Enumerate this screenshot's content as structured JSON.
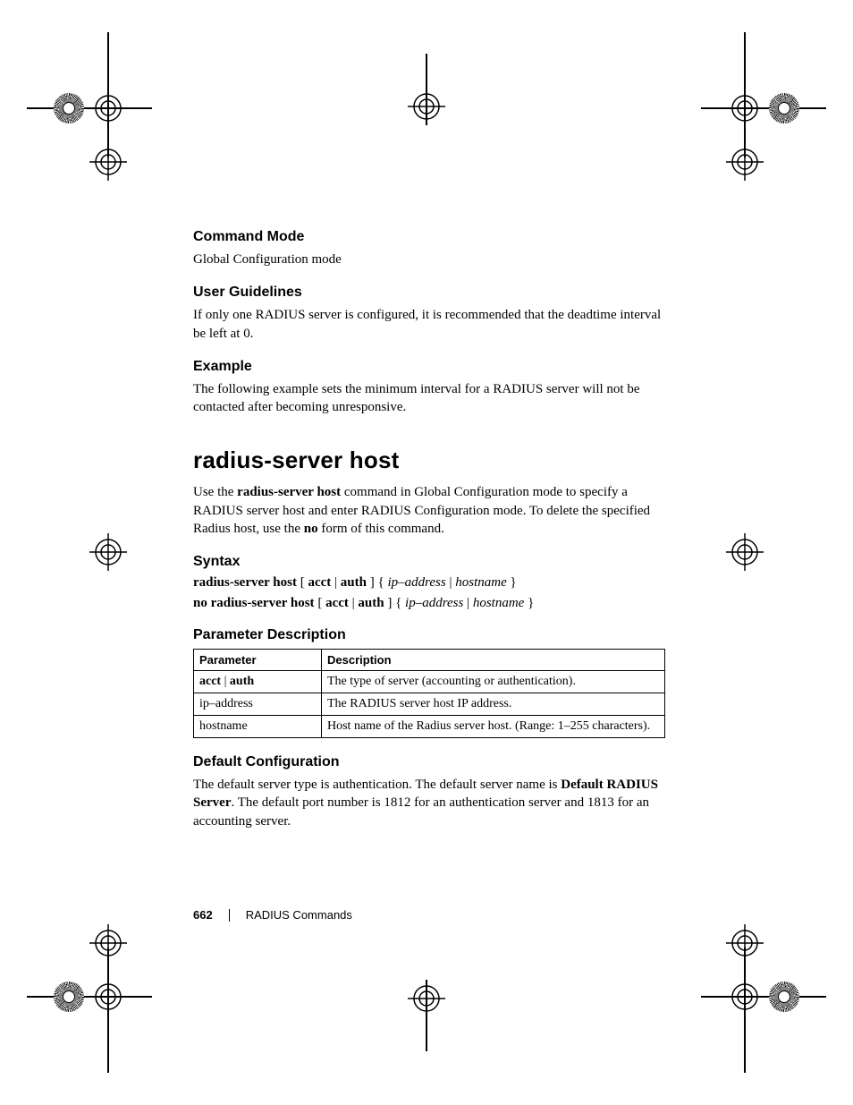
{
  "sections": {
    "command_mode": {
      "heading": "Command Mode",
      "body": "Global Configuration mode"
    },
    "user_guidelines": {
      "heading": "User Guidelines",
      "body": "If only one RADIUS server is configured, it is recommended that the deadtime interval be left at 0."
    },
    "example": {
      "heading": "Example",
      "body": "The following example sets the minimum interval for a RADIUS server will not be contacted after becoming unresponsive."
    },
    "main_heading": "radius-server host",
    "intro": {
      "pre": "Use the ",
      "bold1": "radius-server host",
      "mid": " command in Global Configuration mode to specify a RADIUS server host and enter RADIUS Configuration mode. To delete the specified Radius host, use the ",
      "bold2": "no",
      "post": " form of this command."
    },
    "syntax": {
      "heading": "Syntax",
      "line1": {
        "b1": "radius-server host",
        "t1": " [ ",
        "b2": "acct",
        "t2": " | ",
        "b3": "auth",
        "t3": " ] { ",
        "i1": "ip–address",
        "t4": " | ",
        "i2": "hostname",
        "t5": " }"
      },
      "line2": {
        "b1": "no radius-server host",
        "t1": " [ ",
        "b2": "acct",
        "t2": " | ",
        "b3": "auth",
        "t3": " ] { ",
        "i1": "ip–address",
        "t4": " | ",
        "i2": "hostname",
        "t5": " }"
      }
    },
    "param_desc": {
      "heading": "Parameter Description",
      "headers": {
        "c1": "Parameter",
        "c2": "Description"
      },
      "rows": [
        {
          "p_b1": "acct",
          "p_sep": " | ",
          "p_b2": "auth",
          "d": "The type of server (accounting or authentication)."
        },
        {
          "p": "ip–address",
          "d": "The RADIUS server host IP address."
        },
        {
          "p": "hostname",
          "d": "Host name of the Radius server host. (Range: 1–255 characters)."
        }
      ]
    },
    "default_config": {
      "heading": "Default Configuration",
      "pre": "The default server type is authentication. The default server name is ",
      "bold": "Default RADIUS Server",
      "post": ". The default port number is 1812 for an authentication server and 1813 for an accounting server."
    }
  },
  "footer": {
    "page_number": "662",
    "section_title": "RADIUS Commands"
  }
}
